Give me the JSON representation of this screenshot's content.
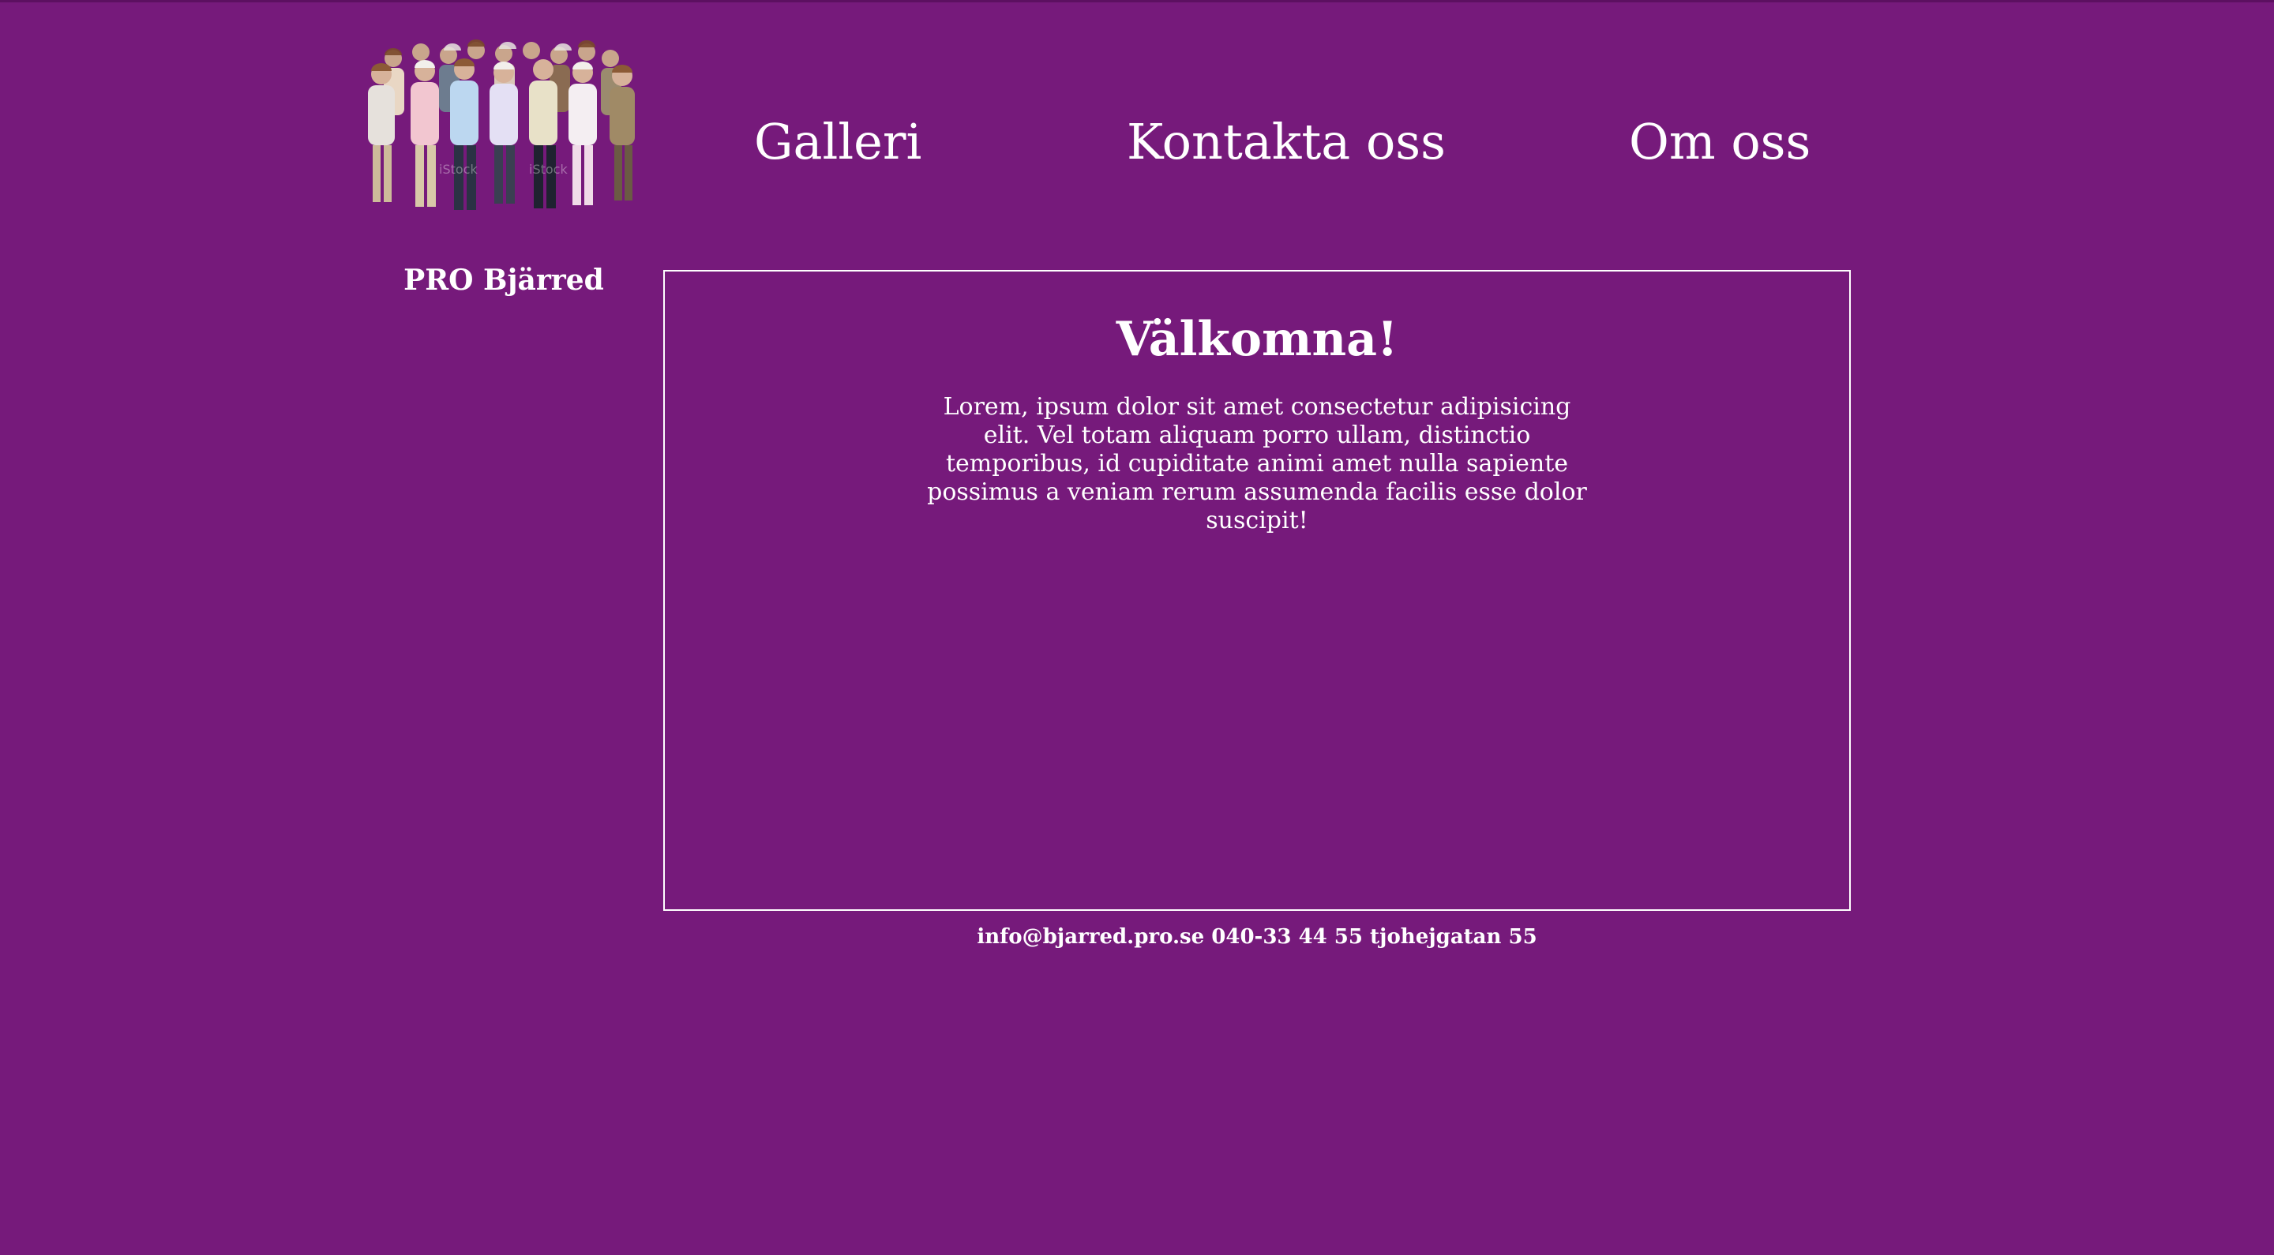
{
  "brand": {
    "title": "PRO Bjärred",
    "photo_alt": "group-of-seniors-photo"
  },
  "nav": {
    "items": [
      {
        "label": "Galleri"
      },
      {
        "label": "Kontakta oss"
      },
      {
        "label": "Om oss"
      }
    ]
  },
  "main": {
    "heading": "Välkomna!",
    "body": "Lorem, ipsum dolor sit amet consectetur adipisicing elit. Vel totam aliquam porro ullam, distinctio temporibus, id cupiditate animi amet nulla sapiente possimus a veniam rerum assumenda facilis esse dolor suscipit!"
  },
  "footer": {
    "contact": "info@bjarred.pro.se 040-33 44 55 tjohejgatan 55"
  },
  "colors": {
    "background": "#761a7b",
    "text": "#ffffff",
    "border": "#ffffff"
  }
}
